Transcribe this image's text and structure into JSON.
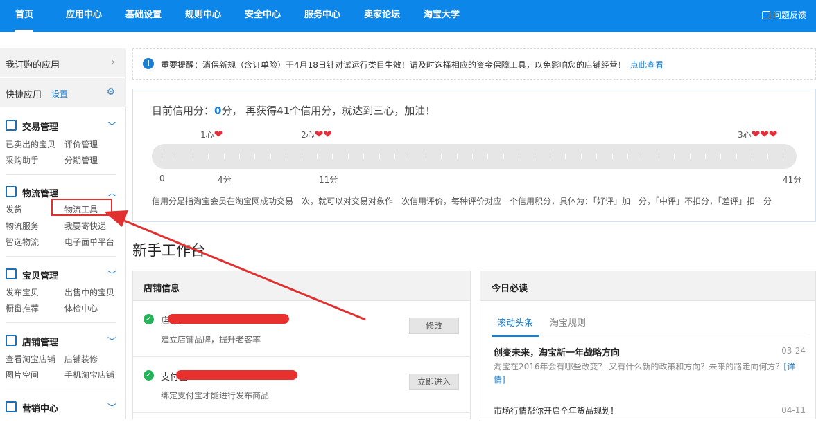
{
  "topnav": {
    "items": [
      "首页",
      "应用中心",
      "基础设置",
      "规则中心",
      "安全中心",
      "服务中心",
      "卖家论坛",
      "淘宝大学"
    ],
    "feedback": "问题反馈"
  },
  "sidebar": {
    "subscribed_apps": "我订购的应用",
    "quick_apps": "快捷应用",
    "settings_link": "设置",
    "groups": [
      {
        "title": "交易管理",
        "links": [
          "已卖出的宝贝",
          "评价管理",
          "采购助手",
          "分期管理"
        ]
      },
      {
        "title": "物流管理",
        "links": [
          "发货",
          "物流工具",
          "物流服务",
          "我要寄快递",
          "智选物流",
          "电子面单平台"
        ]
      },
      {
        "title": "宝贝管理",
        "links": [
          "发布宝贝",
          "出售中的宝贝",
          "橱窗推荐",
          "体检中心"
        ]
      },
      {
        "title": "店铺管理",
        "links": [
          "查看淘宝店铺",
          "店铺装修",
          "图片空间",
          "手机淘宝店铺"
        ]
      },
      {
        "title": "营销中心",
        "links": []
      }
    ]
  },
  "notice": {
    "text": "重要提醒：消保新规（含订单险）于4月18日针对试运行类目生效！请及时选择相应的资金保障工具，以免影响您的店铺经营！",
    "link": "点此查看"
  },
  "credit": {
    "title_prefix": "目前信用分：",
    "score": "0",
    "title_suffix": "分，  再获得41个信用分，就达到三心，加油！",
    "levels": [
      "1心",
      "2心",
      "3心"
    ],
    "scale": [
      "0",
      "4分",
      "11分",
      "41分"
    ],
    "description": "信用分是指淘宝会员在淘宝网成功交易一次，就可以对交易对象作一次信用评价，每种评价对应一个信用积分，具体为：「好评」加一分，「中评」不扣分，「差评」扣一分"
  },
  "workbench": {
    "title": "新手工作台"
  },
  "store_info": {
    "header": "店铺信息",
    "items": [
      {
        "name": "店铺",
        "sub": "建立店铺品牌，提升老客率",
        "button": "修改"
      },
      {
        "name": "支付宝",
        "sub": "绑定支付宝才能进行发布商品",
        "button": "立即进入"
      }
    ]
  },
  "today": {
    "header": "今日必读",
    "tabs": [
      "滚动头条",
      "淘宝规则"
    ],
    "news": [
      {
        "title": "创变未来，淘宝新一年战略方向",
        "date": "03-24",
        "desc": "淘宝在2016年会有哪些改变？ 又有什么新的政策和方向？未来的路走向何方？",
        "more": "[详情]"
      },
      {
        "title": "市场行情帮你开启全年货品规划！",
        "date": "04-11"
      }
    ]
  },
  "colors": {
    "brand_blue": "#0c86e8",
    "heart_red": "#e62e3a",
    "check_green": "#23b45a",
    "annotation_red": "#e03030"
  }
}
